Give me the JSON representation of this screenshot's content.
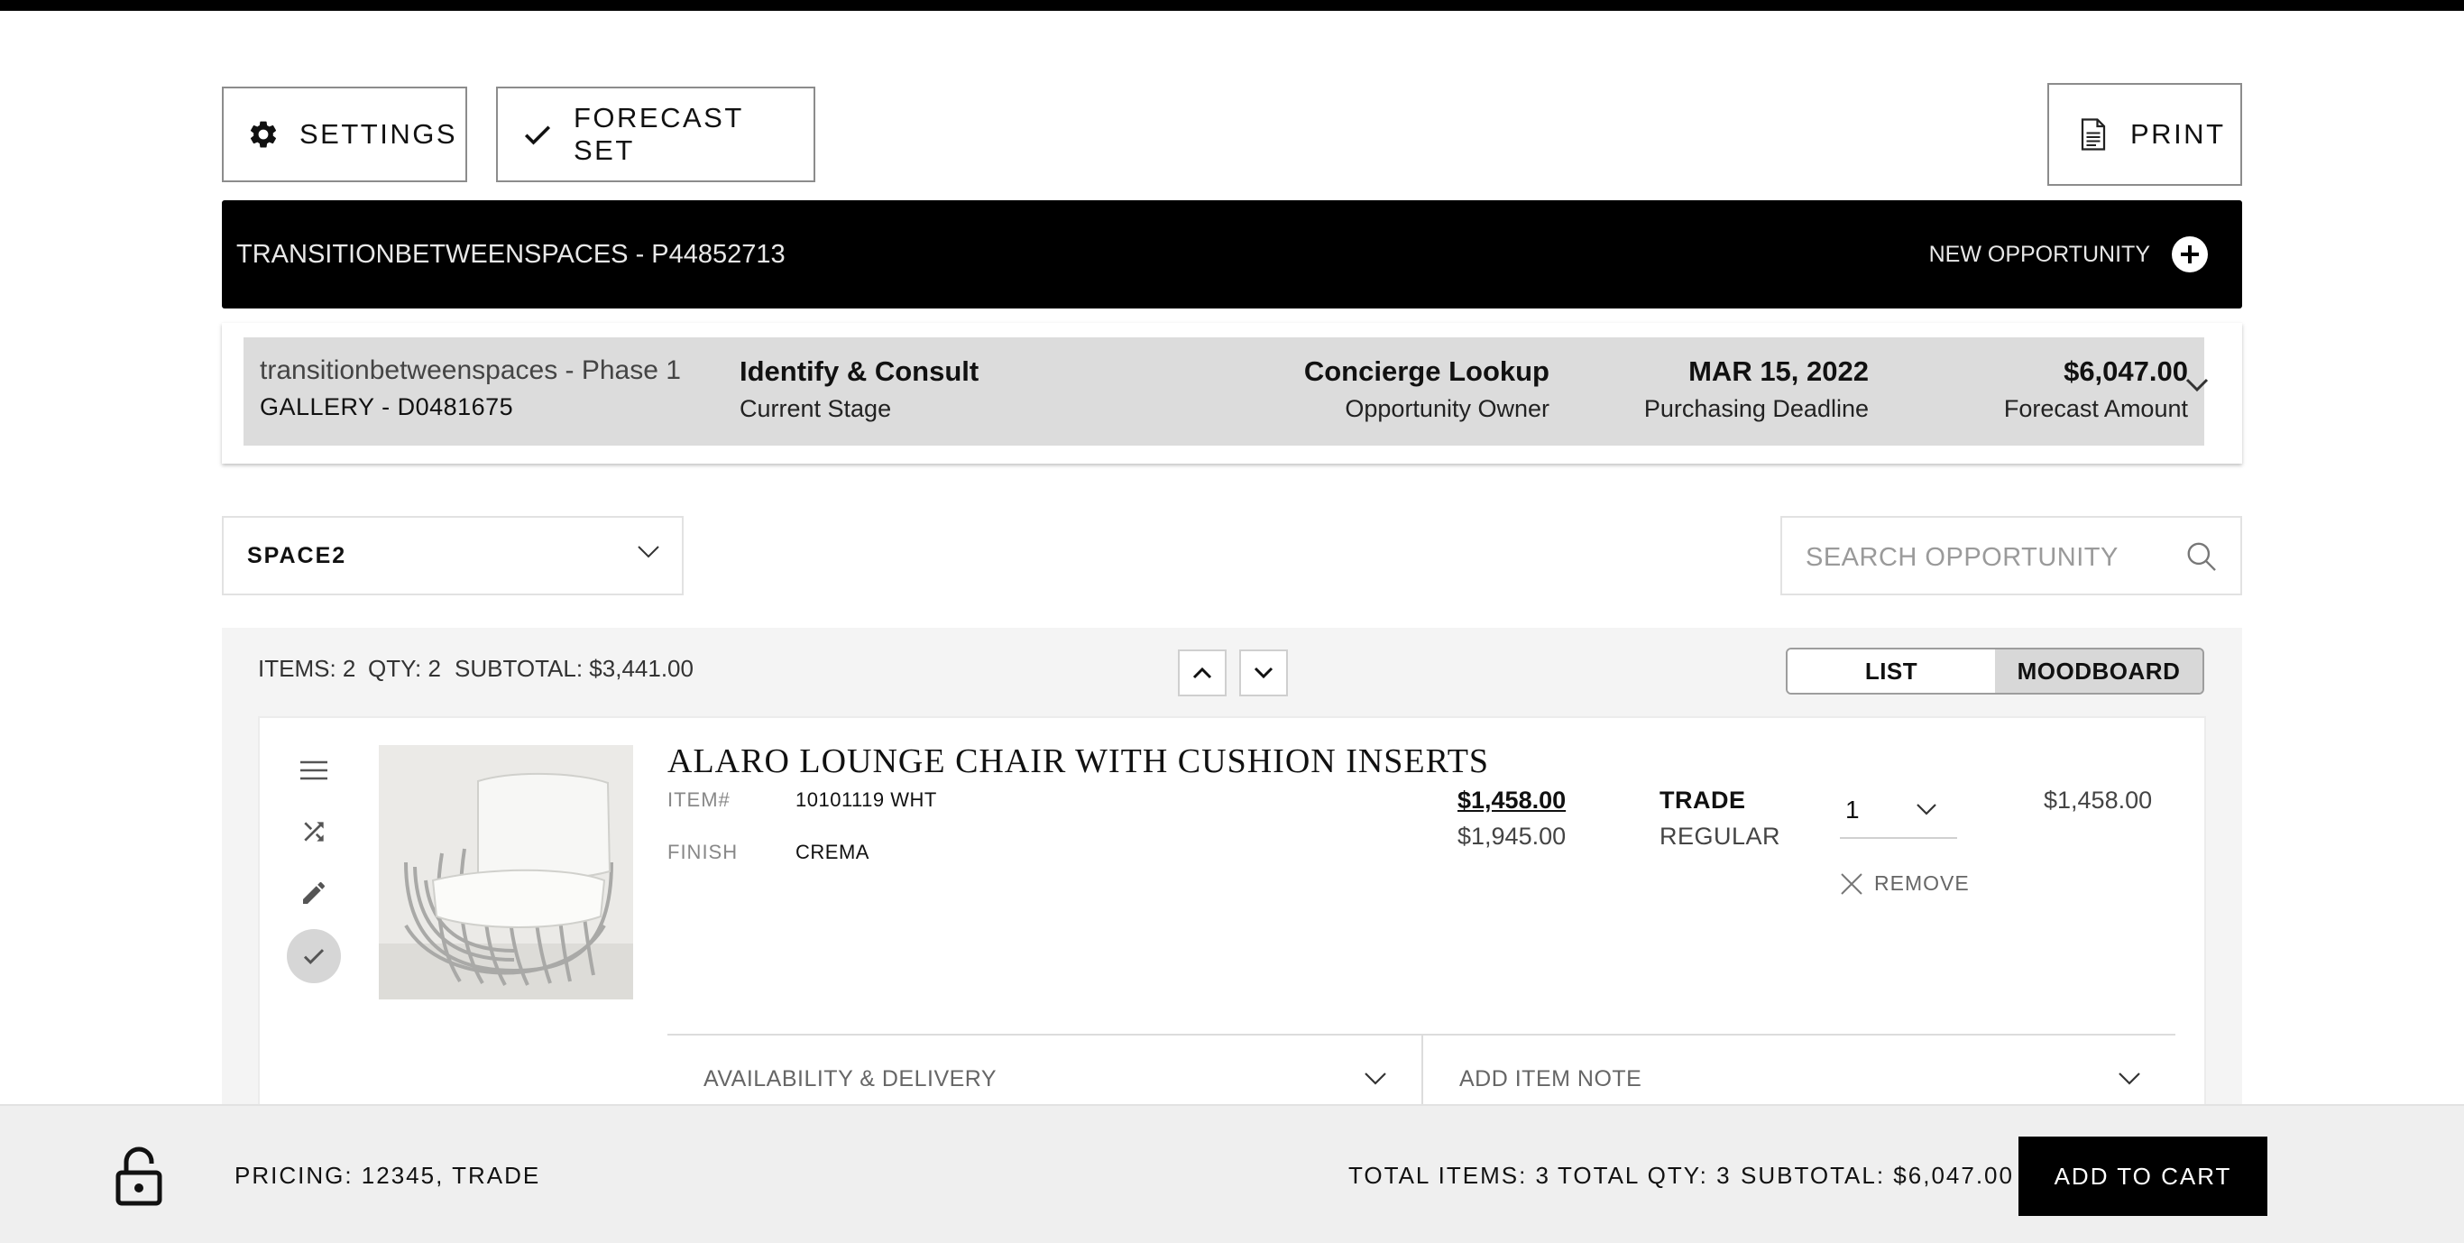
{
  "toolbar": {
    "settings_label": "SETTINGS",
    "forecast_label": "FORECAST SET",
    "print_label": "PRINT"
  },
  "banner": {
    "title": "TRANSITIONBETWEENSPACES - P44852713",
    "new_opportunity_label": "NEW OPPORTUNITY"
  },
  "opportunity": {
    "name": "transitionbetweenspaces - Phase 1",
    "gallery": "GALLERY - D0481675",
    "stage": "Identify & Consult",
    "stage_label": "Current Stage",
    "owner": "Concierge Lookup",
    "owner_label": "Opportunity Owner",
    "deadline": "MAR 15, 2022",
    "deadline_label": "Purchasing Deadline",
    "amount": "$6,047.00",
    "amount_label": "Forecast Amount"
  },
  "space_select": {
    "value": "SPACE2"
  },
  "search": {
    "placeholder": "SEARCH OPPORTUNITY"
  },
  "summary": {
    "items": "ITEMS: 2",
    "qty": "QTY: 2",
    "subtotal": "SUBTOTAL: $3,441.00"
  },
  "view_toggle": {
    "list_label": "LIST",
    "moodboard_label": "MOODBOARD",
    "active": "LIST"
  },
  "item": {
    "title": "ALARO LOUNGE CHAIR WITH CUSHION INSERTS",
    "item_label": "ITEM#",
    "item_number": "10101119 WHT",
    "finish_label": "FINISH",
    "finish": "CREMA",
    "trade_price": "$1,458.00",
    "regular_price": "$1,945.00",
    "trade_label": "TRADE",
    "regular_label": "REGULAR",
    "quantity": "1",
    "remove_label": "REMOVE",
    "line_total": "$1,458.00",
    "availability_label": "AVAILABILITY & DELIVERY",
    "note_label": "ADD ITEM NOTE"
  },
  "footer": {
    "pricing": "PRICING: 12345, TRADE",
    "total_items": "TOTAL ITEMS: 3",
    "total_qty": "TOTAL QTY: 3",
    "subtotal": "SUBTOTAL: $6,047.00",
    "add_to_cart_label": "ADD TO CART"
  },
  "icons": {
    "settings": "gear-icon",
    "forecast": "check-icon",
    "print": "document-icon",
    "new_opportunity": "plus-circle-icon",
    "expand": "chevron-down-icon",
    "search": "search-icon",
    "drag": "hamburger-icon",
    "swap": "shuffle-icon",
    "edit": "pencil-icon",
    "approve": "check-circle-icon",
    "remove": "close-icon",
    "lock": "unlock-icon"
  }
}
